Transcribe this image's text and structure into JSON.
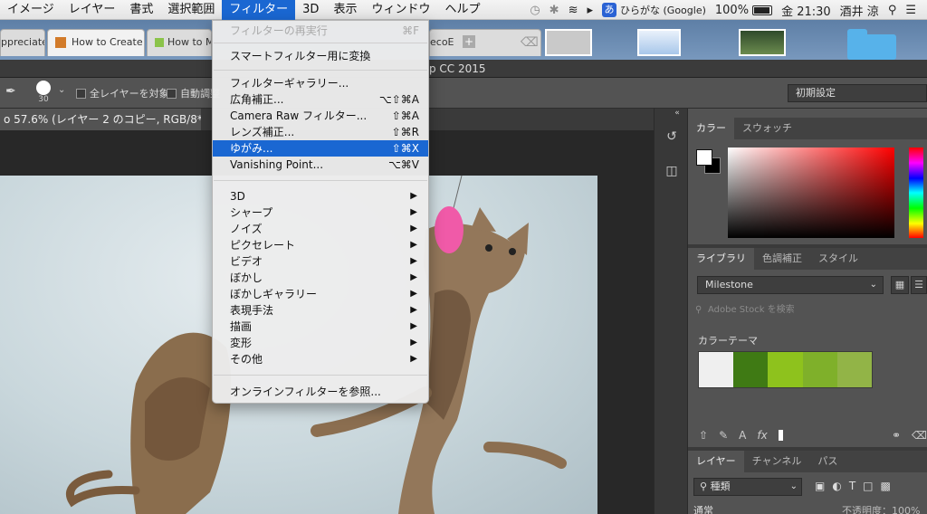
{
  "menubar": {
    "items": [
      "イメージ",
      "レイヤー",
      "書式",
      "選択範囲",
      "フィルター",
      "3D",
      "表示",
      "ウィンドウ",
      "ヘルプ"
    ],
    "active_index": 4,
    "status": {
      "input_method": "ひらがな (Google)",
      "input_method_badge": "あ",
      "battery": "100%",
      "clock": "金 21:30",
      "user": "酒井 涼"
    }
  },
  "browser_tabs": [
    "ppreciate:",
    "How to Create a",
    "How to M",
    "ecoE"
  ],
  "ps_title": "p CC 2015",
  "options_bar": {
    "brush_size": "30",
    "sample_all_layers": "全レイヤーを対象",
    "auto_adjust": "自動調整",
    "workspace": "初期設定"
  },
  "document_tab": "o 57.6% (レイヤー 2 のコピー, RGB/8*) *",
  "filter_menu": {
    "items": [
      {
        "label": "フィルターの再実行",
        "shortcut": "⌘F",
        "disabled": true,
        "submenu": false
      },
      {
        "label": "スマートフィルター用に変換",
        "shortcut": "",
        "disabled": false,
        "submenu": false
      },
      {
        "label": "フィルターギャラリー...",
        "shortcut": "",
        "disabled": false,
        "submenu": false
      },
      {
        "label": "広角補正...",
        "shortcut": "⌥⇧⌘A",
        "disabled": false,
        "submenu": false
      },
      {
        "label": "Camera Raw フィルター...",
        "shortcut": "⇧⌘A",
        "disabled": false,
        "submenu": false
      },
      {
        "label": "レンズ補正...",
        "shortcut": "⇧⌘R",
        "disabled": false,
        "submenu": false
      },
      {
        "label": "ゆがみ...",
        "shortcut": "⇧⌘X",
        "disabled": false,
        "submenu": false,
        "highlighted": true
      },
      {
        "label": "Vanishing Point...",
        "shortcut": "⌥⌘V",
        "disabled": false,
        "submenu": false
      },
      {
        "label": "3D",
        "shortcut": "",
        "disabled": false,
        "submenu": true
      },
      {
        "label": "シャープ",
        "shortcut": "",
        "disabled": false,
        "submenu": true
      },
      {
        "label": "ノイズ",
        "shortcut": "",
        "disabled": false,
        "submenu": true
      },
      {
        "label": "ピクセレート",
        "shortcut": "",
        "disabled": false,
        "submenu": true
      },
      {
        "label": "ビデオ",
        "shortcut": "",
        "disabled": false,
        "submenu": true
      },
      {
        "label": "ぼかし",
        "shortcut": "",
        "disabled": false,
        "submenu": true
      },
      {
        "label": "ぼかしギャラリー",
        "shortcut": "",
        "disabled": false,
        "submenu": true
      },
      {
        "label": "表現手法",
        "shortcut": "",
        "disabled": false,
        "submenu": true
      },
      {
        "label": "描画",
        "shortcut": "",
        "disabled": false,
        "submenu": true
      },
      {
        "label": "変形",
        "shortcut": "",
        "disabled": false,
        "submenu": true
      },
      {
        "label": "その他",
        "shortcut": "",
        "disabled": false,
        "submenu": true
      },
      {
        "label": "オンラインフィルターを参照...",
        "shortcut": "",
        "disabled": false,
        "submenu": false
      }
    ]
  },
  "color_panel": {
    "tabs": [
      "カラー",
      "スウォッチ"
    ],
    "foreground": "#ffffff",
    "background": "#000000",
    "hue": "#ff0000"
  },
  "library_panel": {
    "tabs": [
      "ライブラリ",
      "色調補正",
      "スタイル"
    ],
    "library_name": "Milestone",
    "search_placeholder": "Adobe Stock を検索",
    "theme_label": "カラーテーマ",
    "theme_colors": [
      "#efefef",
      "#3f7a14",
      "#8ec21d",
      "#7fb02a",
      "#92b447"
    ]
  },
  "layers_panel": {
    "tabs": [
      "レイヤー",
      "チャンネル",
      "パス"
    ],
    "kind_filter": "種類",
    "blend_mode": "通常",
    "opacity_label": "不透明度：100%"
  }
}
